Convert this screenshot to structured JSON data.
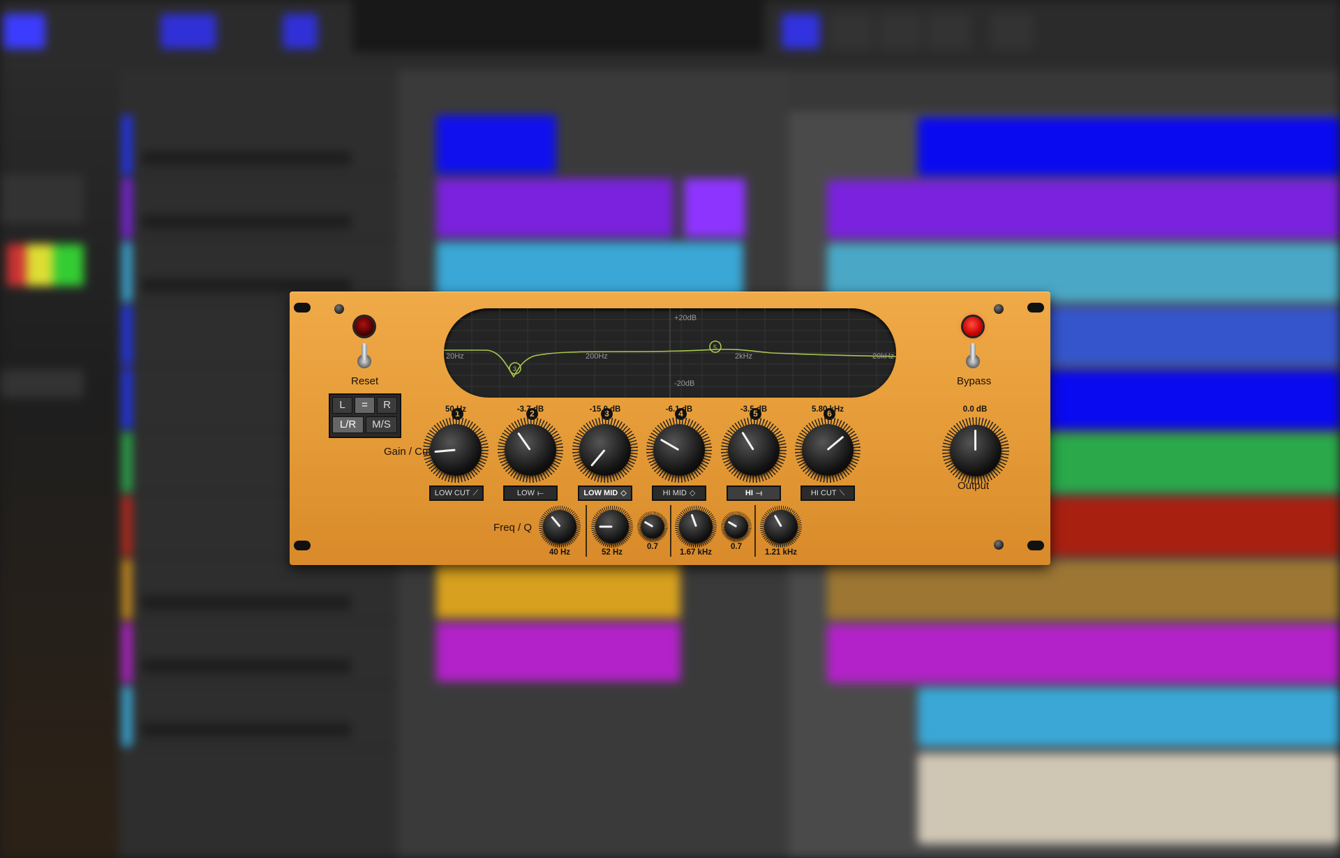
{
  "plugin": {
    "left": {
      "reset_label": "Reset"
    },
    "right": {
      "bypass_label": "Bypass"
    },
    "stereo": {
      "l": "L",
      "link": "=",
      "r": "R",
      "lr": "L/R",
      "ms": "M/S"
    },
    "gain_cutoff_label": "Gain / Cutoff",
    "freq_q_label": "Freq / Q",
    "output": {
      "value": "0.0 dB",
      "label": "Output"
    },
    "display": {
      "db_top": "+20dB",
      "db_bottom": "-20dB",
      "freq_labels": [
        "20Hz",
        "200Hz",
        "2kHz",
        "20kHz"
      ],
      "node_labels": [
        "3",
        "5"
      ]
    },
    "bands": [
      {
        "num": "1",
        "value": "50 Hz",
        "type": "LOW CUT"
      },
      {
        "num": "2",
        "value": "-3.7 dB",
        "type": "LOW"
      },
      {
        "num": "3",
        "value": "-15.0 dB",
        "type": "LOW MID"
      },
      {
        "num": "4",
        "value": "-6.1 dB",
        "type": "HI MID"
      },
      {
        "num": "5",
        "value": "-3.5 dB",
        "type": "HI"
      },
      {
        "num": "6",
        "value": "5.80 kHz",
        "type": "HI CUT"
      }
    ],
    "freq_knobs": [
      {
        "value": "40 Hz"
      },
      {
        "value": "52 Hz"
      },
      {
        "value": "0.7"
      },
      {
        "value": "1.67 kHz"
      },
      {
        "value": "0.7"
      },
      {
        "value": "1.21 kHz"
      }
    ]
  },
  "colors": {
    "faceplate": "#e8a03c",
    "led_on": "#ff3b30",
    "curve": "#a9c94a"
  },
  "icons": {
    "low_cut_shape": "lowcut-shape-icon",
    "low_shape": "lowshelf-shape-icon",
    "bell_shape": "bell-shape-icon",
    "hi_shape": "hishelf-shape-icon",
    "hi_cut_shape": "hicut-shape-icon"
  }
}
